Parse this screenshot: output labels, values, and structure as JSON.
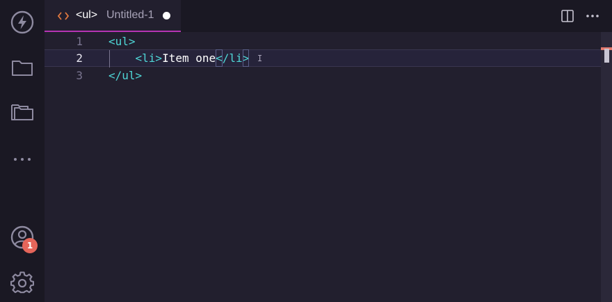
{
  "colors": {
    "background": "#221f2e",
    "activity_bar": "#1a1823",
    "tab_accent": "#b534b3",
    "tag": "#4fd6d6",
    "badge": "#e5655a"
  },
  "activity_bar": {
    "items": [
      {
        "name": "lightning",
        "icon": "lightning-icon"
      },
      {
        "name": "explorer",
        "icon": "folder-icon"
      },
      {
        "name": "open-folders",
        "icon": "folders-icon"
      },
      {
        "name": "more",
        "icon": "ellipsis-icon"
      }
    ],
    "account": {
      "icon": "account-icon",
      "badge": "1"
    },
    "settings": {
      "icon": "gear-icon"
    }
  },
  "tab": {
    "name": "<ul>",
    "description": "Untitled-1",
    "icon": "code-brackets-icon",
    "dirty": true
  },
  "top_actions": [
    {
      "icon": "split-editor-icon"
    },
    {
      "icon": "more-actions-icon"
    }
  ],
  "editor": {
    "current_line": 2,
    "lines": [
      {
        "num": "1",
        "indent": "",
        "open": "<ul>",
        "text": "",
        "close": ""
      },
      {
        "num": "2",
        "indent": "    ",
        "open": "<li>",
        "text": "Item one",
        "close_lt": "<",
        "close_mid": "/li",
        "close_gt": ">"
      },
      {
        "num": "3",
        "indent": "",
        "open": "</ul>",
        "text": "",
        "close": ""
      }
    ]
  }
}
